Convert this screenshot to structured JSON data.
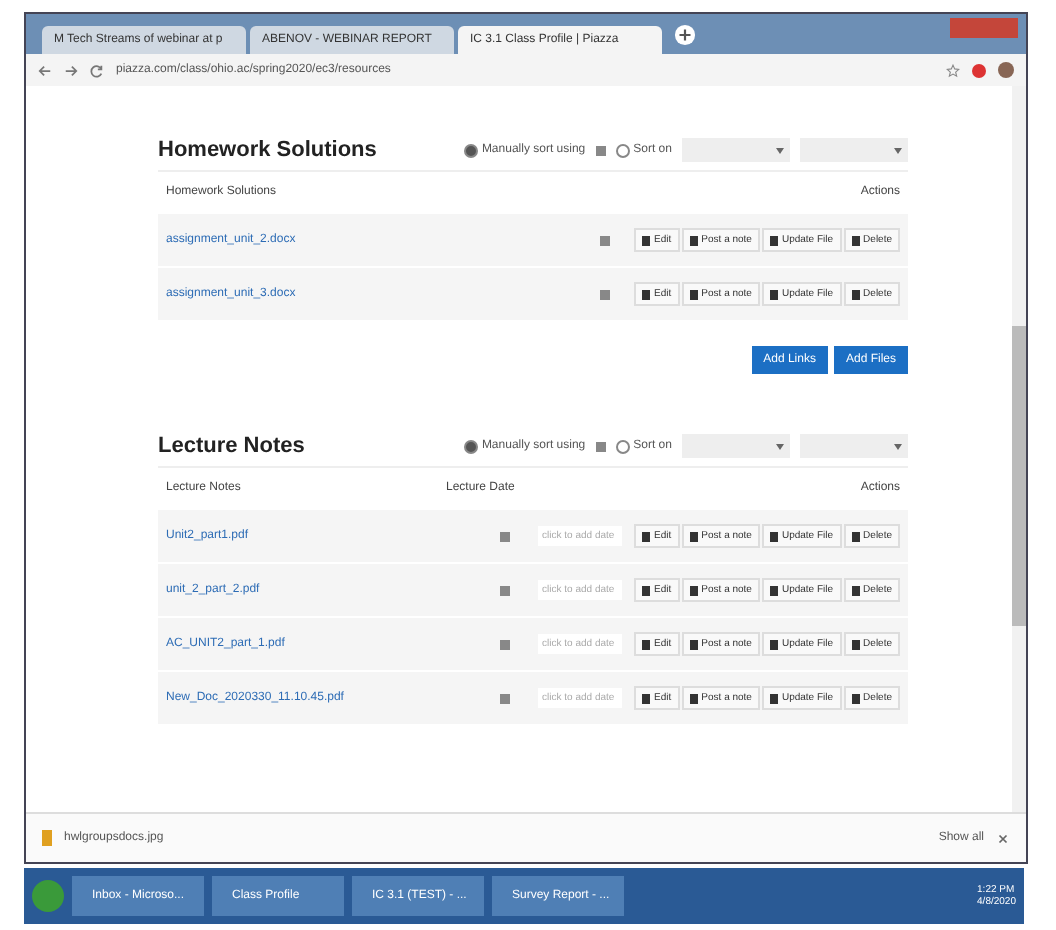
{
  "browser": {
    "tabs": [
      {
        "title": "M Tech Streams of webinar at p",
        "selected": false
      },
      {
        "title": "ABENOV - WEBINAR REPORT",
        "selected": false
      },
      {
        "title": "IC 3.1 Class Profile | Piazza",
        "selected": true
      }
    ],
    "url": "piazza.com/class/ohio.ac/spring2020/ec3/resources"
  },
  "sections": [
    {
      "title": "Homework Solutions",
      "manual_sort": {
        "label": "Manually sort using",
        "selected": true
      },
      "sort_on": {
        "label": "Sort on",
        "selected": false
      },
      "columns": [
        "Homework Solutions",
        "Actions"
      ],
      "rows": [
        {
          "name": "assignment_unit_2.docx",
          "actions": [
            "Edit",
            "Post a note",
            "Update File",
            "Delete"
          ]
        },
        {
          "name": "assignment_unit_3.docx",
          "actions": [
            "Edit",
            "Post a note",
            "Update File",
            "Delete"
          ]
        }
      ],
      "buttons": [
        "Add Links",
        "Add Files"
      ]
    },
    {
      "title": "Lecture Notes",
      "manual_sort": {
        "label": "Manually sort using",
        "selected": true
      },
      "sort_on": {
        "label": "Sort on",
        "selected": false
      },
      "columns": [
        "Lecture Notes",
        "Lecture Date",
        "Actions"
      ],
      "rows": [
        {
          "name": "Unit2_part1.pdf",
          "date_placeholder": "click to add date",
          "actions": [
            "Edit",
            "Post a note",
            "Update File",
            "Delete"
          ]
        },
        {
          "name": "unit_2_part_2.pdf",
          "date_placeholder": "click to add date",
          "actions": [
            "Edit",
            "Post a note",
            "Update File",
            "Delete"
          ]
        },
        {
          "name": "AC_UNIT2_part_1.pdf",
          "date_placeholder": "click to add date",
          "actions": [
            "Edit",
            "Post a note",
            "Update File",
            "Delete"
          ]
        },
        {
          "name": "New_Doc_2020330_11.10.45.pdf",
          "date_placeholder": "click to add date",
          "actions": [
            "Edit",
            "Post a note",
            "Update File",
            "Delete"
          ]
        }
      ]
    }
  ],
  "download_bar": {
    "file": "hwlgroupsdocs.jpg",
    "show_all": "Show all"
  },
  "taskbar": {
    "items": [
      "Inbox - Microso...",
      "Class Profile",
      "IC 3.1 (TEST) - ...",
      "Survey Report - ..."
    ],
    "time": "1:22 PM",
    "date": "4/8/2020"
  }
}
